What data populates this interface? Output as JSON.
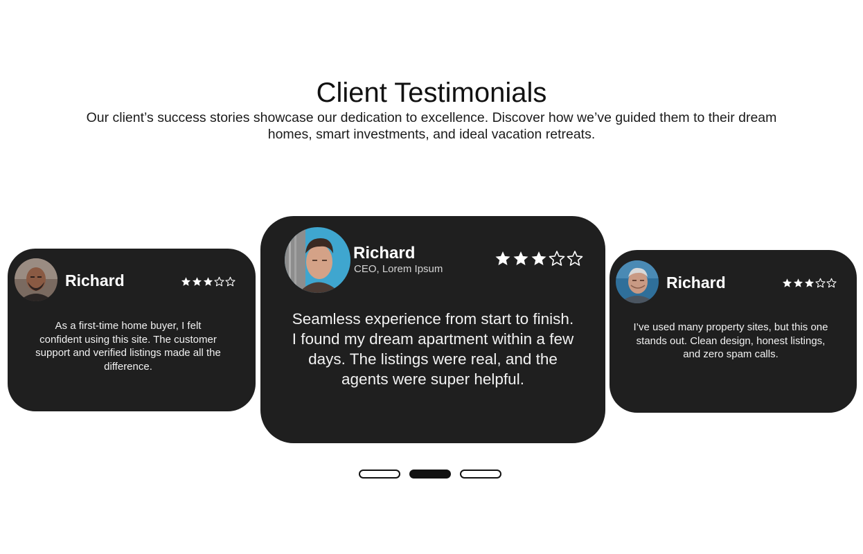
{
  "header": {
    "title": "Client Testimonials",
    "subtitle": "Our client’s success stories showcase our dedication to excellence. Discover how we’ve guided them to their dream homes, smart investments, and ideal vacation retreats."
  },
  "testimonials": [
    {
      "name": "Richard",
      "role": "",
      "rating": 3,
      "max_rating": 5,
      "quote": "As a first-time home buyer, I felt confident using this site. The customer support and verified listings made all the difference."
    },
    {
      "name": "Richard",
      "role": "CEO, Lorem Ipsum",
      "rating": 3,
      "max_rating": 5,
      "quote": "Seamless experience from start to finish. I found my dream apartment within a few days. The listings were real, and the agents were super helpful."
    },
    {
      "name": "Richard",
      "role": "",
      "rating": 3,
      "max_rating": 5,
      "quote": "I’ve used many property sites, but this one stands out. Clean design, honest listings, and zero spam calls."
    }
  ],
  "carousel": {
    "slide_count": 3,
    "active_index": 1
  },
  "colors": {
    "card_background": "#1f1f1f",
    "text_on_card": "#ffffff",
    "dot_active": "#111111"
  }
}
